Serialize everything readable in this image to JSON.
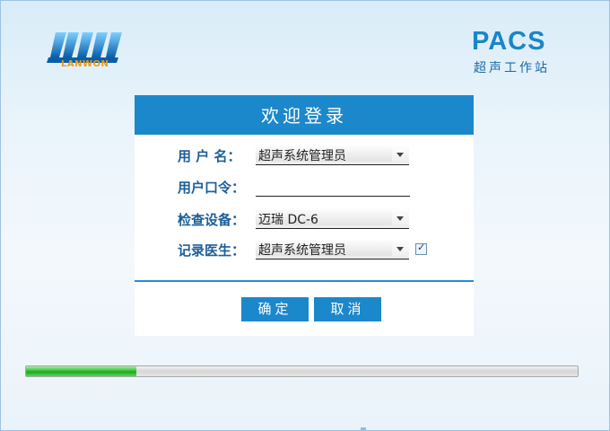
{
  "logo": {
    "text": "LANWON"
  },
  "brand": {
    "title": "PACS",
    "subtitle": "超声工作站"
  },
  "login": {
    "header": "欢迎登录",
    "username": {
      "label": "用 户 名：",
      "value": "超声系统管理员"
    },
    "password": {
      "label": "用户口令：",
      "value": ""
    },
    "device": {
      "label": "检查设备：",
      "value": "迈瑞 DC-6"
    },
    "recorder": {
      "label": "记录医生：",
      "value": "超声系统管理员",
      "checked": true
    },
    "confirm_label": "确定",
    "cancel_label": "取消"
  },
  "progress": {
    "value": 0.2
  },
  "colors": {
    "accent": "#1c88cc",
    "progress": "#34c234",
    "label": "#1c5f98"
  }
}
